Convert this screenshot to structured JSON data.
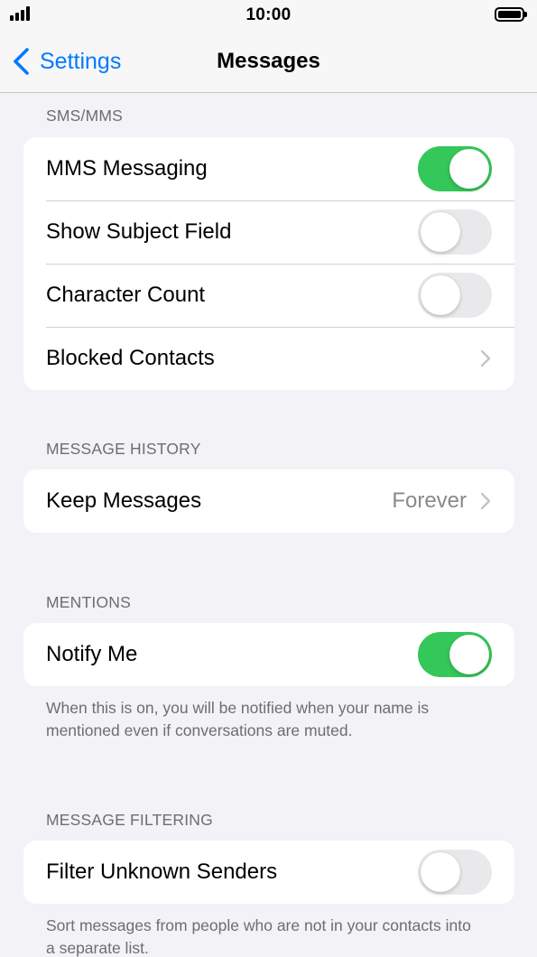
{
  "status_bar": {
    "time": "10:00"
  },
  "nav": {
    "back_label": "Settings",
    "title": "Messages"
  },
  "sections": {
    "sms": {
      "header": "SMS/MMS",
      "rows": [
        {
          "label": "MMS Messaging",
          "toggle": "on"
        },
        {
          "label": "Show Subject Field",
          "toggle": "off"
        },
        {
          "label": "Character Count",
          "toggle": "off"
        },
        {
          "label": "Blocked Contacts"
        }
      ]
    },
    "history": {
      "header": "MESSAGE HISTORY",
      "rows": [
        {
          "label": "Keep Messages",
          "value": "Forever"
        }
      ]
    },
    "mentions": {
      "header": "MENTIONS",
      "rows": [
        {
          "label": "Notify Me",
          "toggle": "on"
        }
      ],
      "footer": "When this is on, you will be notified when your name is mentioned even if conversations are muted."
    },
    "filtering": {
      "header": "MESSAGE FILTERING",
      "rows": [
        {
          "label": "Filter Unknown Senders",
          "toggle": "off"
        }
      ],
      "footer": "Sort messages from people who are not in your contacts into a separate list."
    }
  },
  "colors": {
    "accent": "#007aff",
    "toggle_on": "#34c759",
    "toggle_off": "#e9e9eb"
  },
  "icons": [
    "signal-icon",
    "battery-icon",
    "back-chevron-icon",
    "chevron-right-icon"
  ]
}
